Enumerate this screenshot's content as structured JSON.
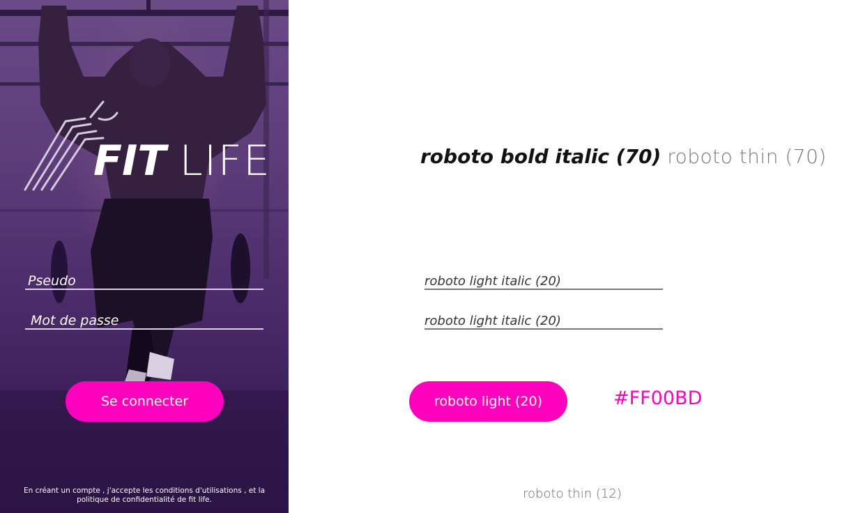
{
  "mockup": {
    "logo": {
      "word1": "FIT",
      "word2": "LIFE"
    },
    "username_placeholder": "Pseudo",
    "password_placeholder": "Mot de passe",
    "login_button": "Se connecter",
    "terms_line1": "En créant un compte , j'accepte les conditions d'utilisations , et la",
    "terms_line2": "politique de confidentialité de fit life."
  },
  "style_guide": {
    "title_bold": "roboto bold italic (70)",
    "title_thin": "roboto thin (70)",
    "field1": "roboto light italic (20)",
    "field2": "roboto light italic (20)",
    "button": "roboto light (20)",
    "accent_hex": "#FF00BD",
    "footer_note": "roboto thin (12)"
  },
  "colors": {
    "accent": "#ff00bd",
    "overlay": "#5b3a78"
  }
}
